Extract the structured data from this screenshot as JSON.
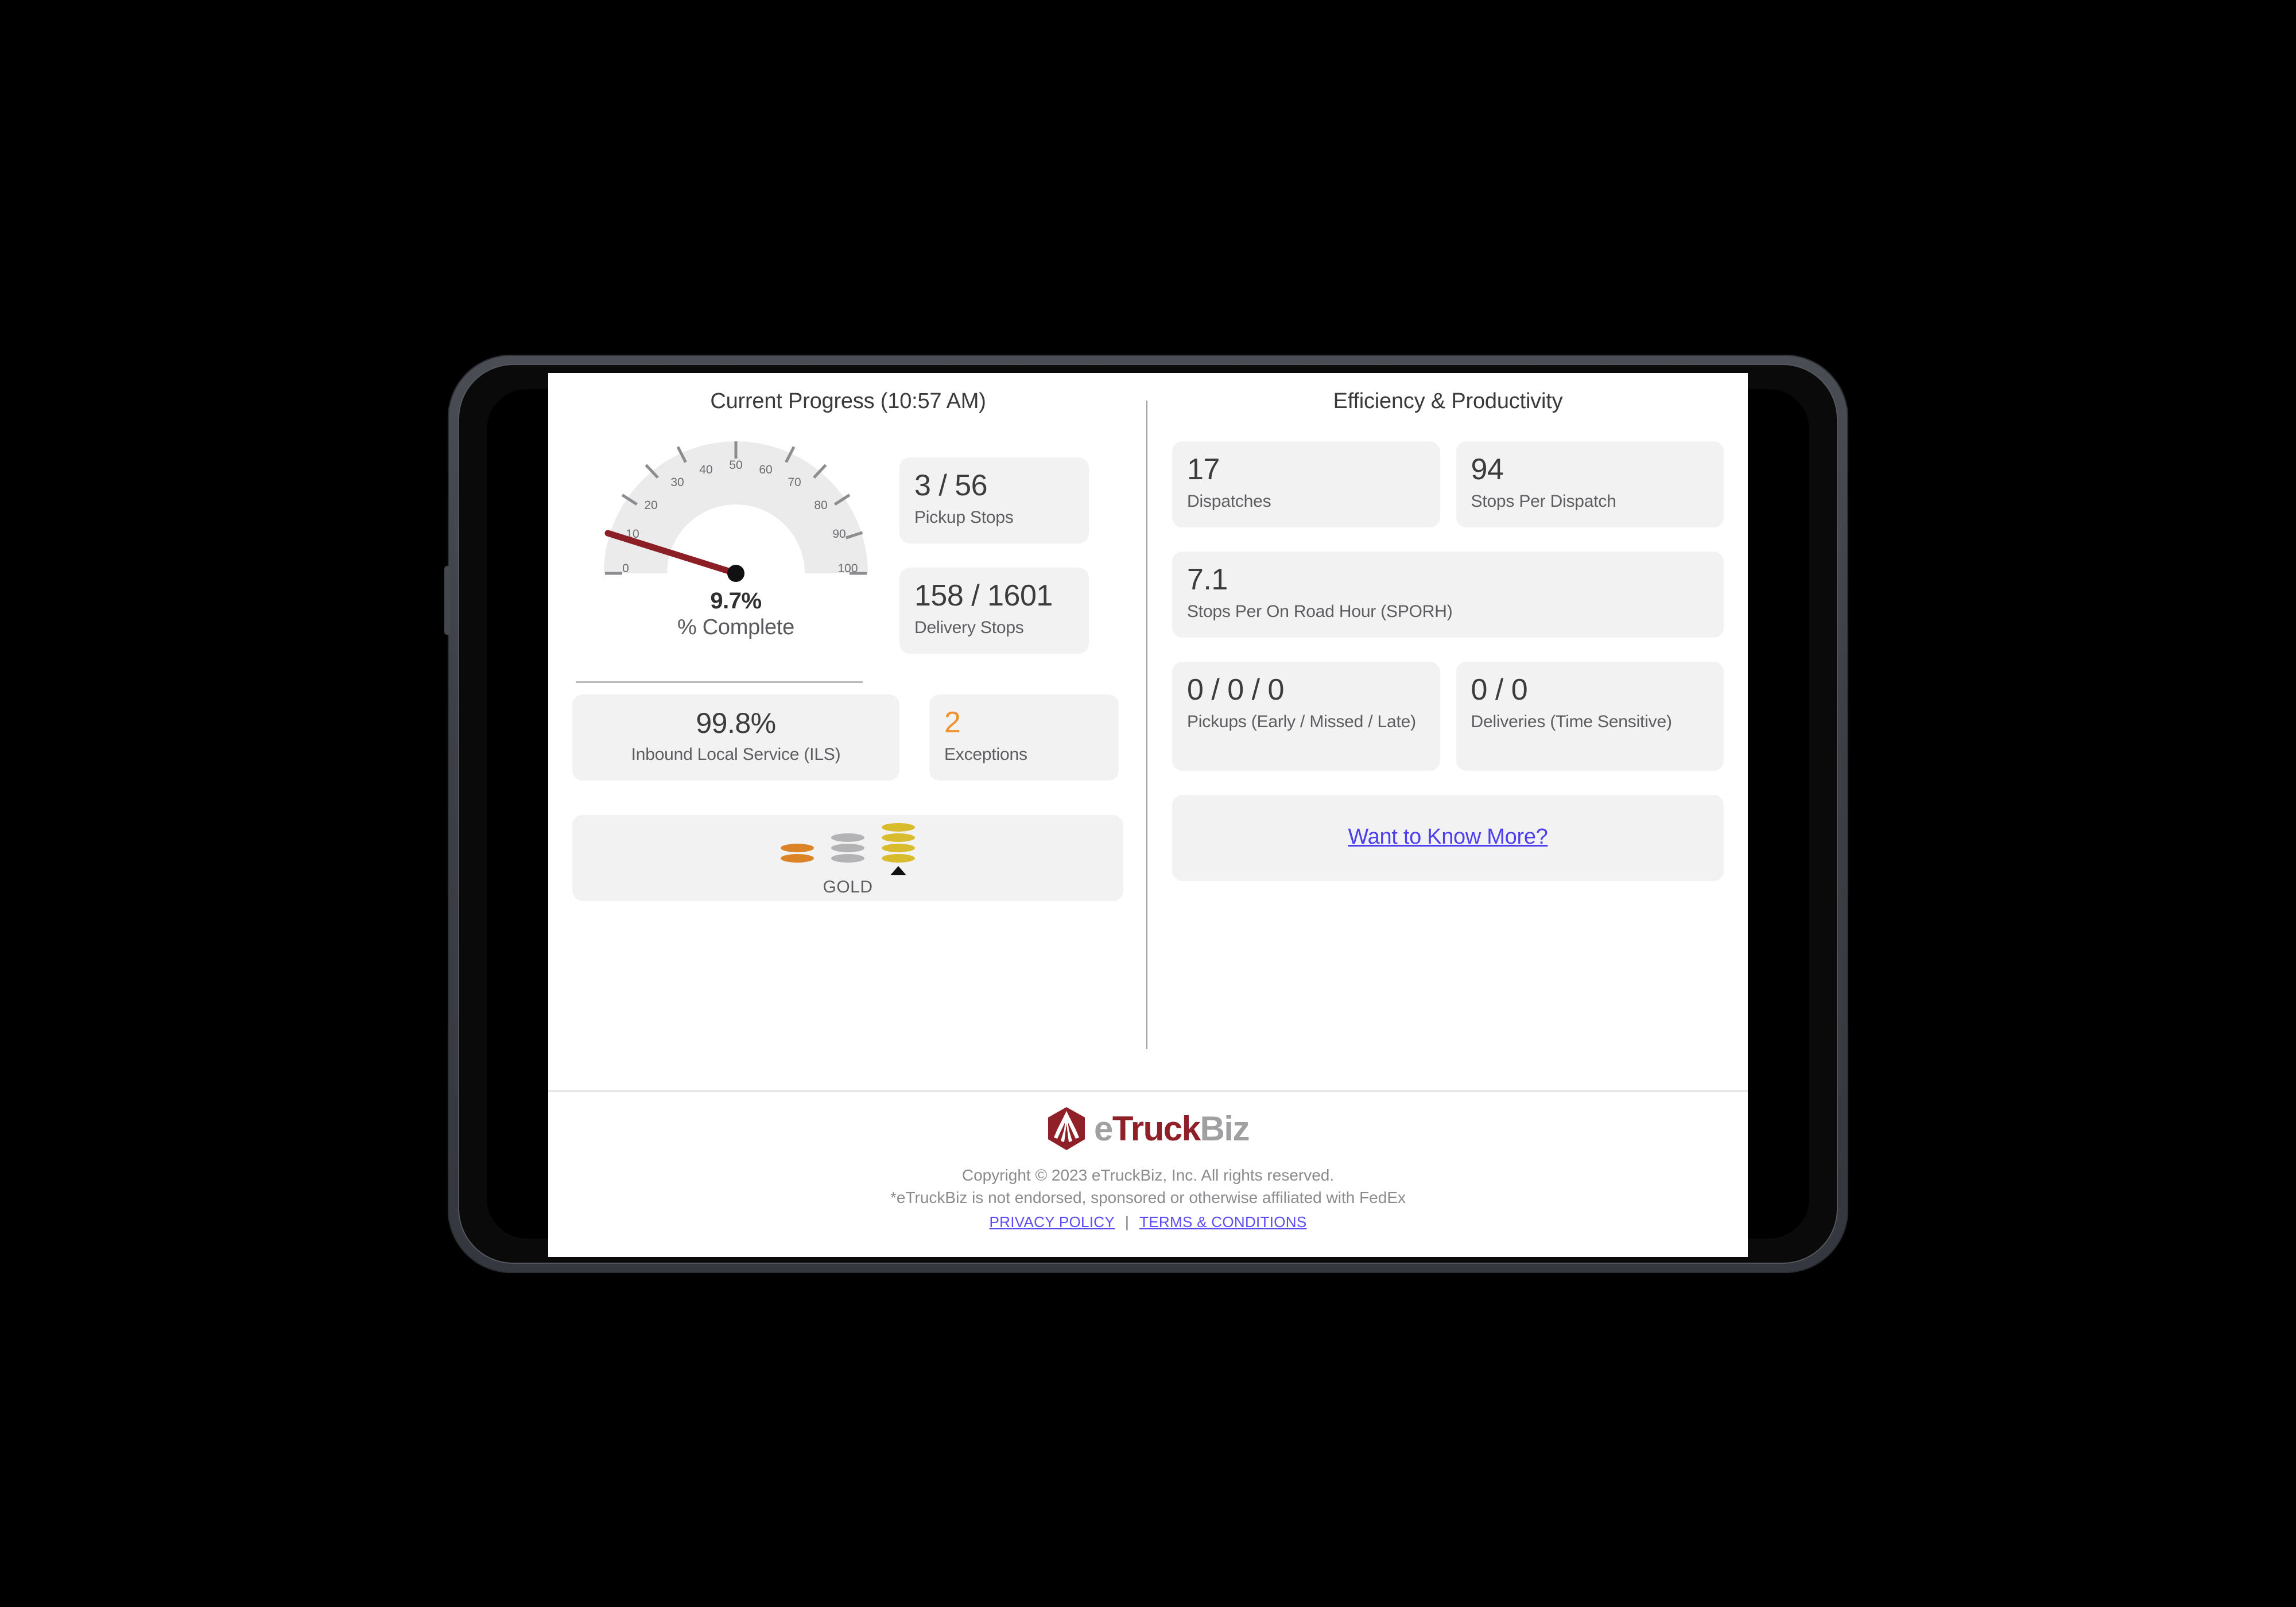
{
  "progress": {
    "section_title": "Current Progress (10:57 AM)",
    "gauge": {
      "value_label": "9.7%",
      "caption": "% Complete",
      "min": 0,
      "max": 100,
      "value": 9.7,
      "tick_labels": [
        "0",
        "10",
        "20",
        "30",
        "40",
        "50",
        "60",
        "70",
        "80",
        "90",
        "100"
      ],
      "needle_color": "#8b1f25",
      "track_color": "#ebebeb"
    },
    "cards": [
      {
        "name": "pickup-stops",
        "value": "3 / 56",
        "label": "Pickup Stops"
      },
      {
        "name": "delivery-stops",
        "value": "158 / 1601",
        "label": "Delivery Stops"
      },
      {
        "name": "exceptions",
        "value": "2",
        "label": "Exceptions",
        "accent_color": "#f0922f"
      },
      {
        "name": "inbound-local-service",
        "value": "99.8%",
        "label": "Inbound Local Service (ILS)"
      }
    ],
    "tier": {
      "label": "GOLD",
      "stacks": [
        {
          "name": "bronze",
          "coins": 2,
          "color": "#dd8327"
        },
        {
          "name": "silver",
          "coins": 3,
          "color": "#b3b3b5"
        },
        {
          "name": "gold",
          "coins": 4,
          "color": "#d9bb2e",
          "selected": true
        }
      ]
    }
  },
  "efficiency": {
    "section_title": "Efficiency & Productivity",
    "cards": [
      {
        "name": "dispatches",
        "value": "17",
        "label": "Dispatches"
      },
      {
        "name": "stops-per-dispatch",
        "value": "94",
        "label": "Stops Per Dispatch"
      },
      {
        "name": "sporh",
        "value": "7.1",
        "label": "Stops Per On Road Hour (SPORH)"
      },
      {
        "name": "pickups-early-missed-late",
        "value": "0 / 0 / 0",
        "label": "Pickups (Early / Missed / Late)"
      },
      {
        "name": "deliveries-time-sensitive",
        "value": "0 / 0",
        "label": "Deliveries (Time Sensitive)"
      }
    ],
    "know_more_link": "Want to Know More?"
  },
  "footer": {
    "logo": {
      "e": "e",
      "truck": "Truck",
      "biz_b": "B",
      "biz_iz": "iz"
    },
    "copyright_line1": "Copyright © 2023 eTruckBiz, Inc. All rights reserved.",
    "copyright_line2": "*eTruckBiz is not endorsed, sponsored or otherwise affiliated with FedEx",
    "privacy_policy": "PRIVACY POLICY",
    "separator": "|",
    "terms": "TERMS & CONDITIONS"
  },
  "chart_data": {
    "type": "gauge",
    "title": "% Complete",
    "value": 9.7,
    "unit": "%",
    "min": 0,
    "max": 100,
    "ticks": [
      0,
      10,
      20,
      30,
      40,
      50,
      60,
      70,
      80,
      90,
      100
    ],
    "categories": [
      "% Complete"
    ],
    "values": [
      9.7
    ],
    "xlabel": "",
    "ylabel": "",
    "ylim": [
      0,
      100
    ]
  }
}
